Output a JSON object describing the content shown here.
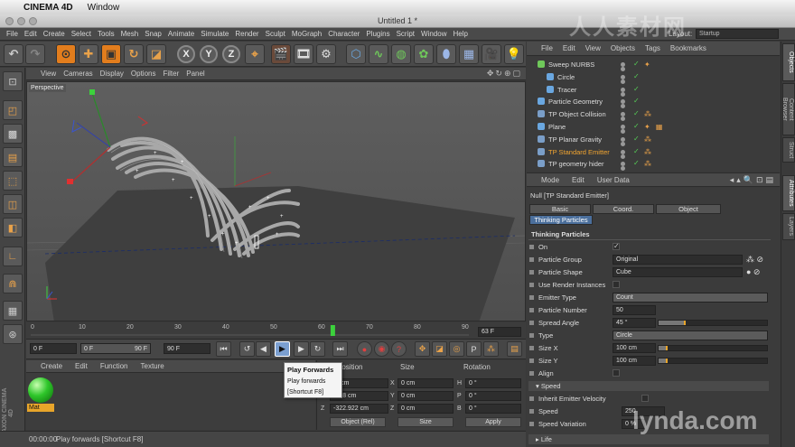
{
  "mac": {
    "apple": "",
    "app": "CINEMA 4D",
    "window": "Window"
  },
  "title": "Untitled 1 *",
  "menu": [
    "File",
    "Edit",
    "Create",
    "Select",
    "Tools",
    "Mesh",
    "Snap",
    "Animate",
    "Simulate",
    "Render",
    "Sculpt",
    "MoGraph",
    "Character",
    "Plugins",
    "Script",
    "Window",
    "Help"
  ],
  "layout_label": "Layout:",
  "layout_value": "Startup",
  "axis": {
    "x": "X",
    "y": "Y",
    "z": "Z"
  },
  "viewport_menu": [
    "View",
    "Cameras",
    "Display",
    "Options",
    "Filter",
    "Panel"
  ],
  "viewport_label": "Perspective",
  "timeline": {
    "ticks": [
      "0",
      "10",
      "20",
      "30",
      "40",
      "50",
      "60",
      "70",
      "80",
      "90"
    ],
    "current": "63 F",
    "playhead_fraction": 0.63
  },
  "transport": {
    "start": "0 F",
    "min": "0 F",
    "max": "90 F",
    "end": "90 F"
  },
  "tooltip": {
    "title": "Play Forwards",
    "desc": "Play forwards",
    "shortcut": "[Shortcut F8]"
  },
  "mat_menu": [
    "Create",
    "Edit",
    "Function",
    "Texture"
  ],
  "material": {
    "name": "Mat",
    "color": "#2ec62a"
  },
  "coord": {
    "headers": [
      "Position",
      "Size",
      "Rotation"
    ],
    "pos": [
      "-0 cm",
      "-868 cm",
      "-322.922 cm"
    ],
    "size_labels": [
      "X",
      "Y",
      "Z"
    ],
    "size": [
      "0 cm",
      "0 cm",
      "0 cm"
    ],
    "rot_labels": [
      "H",
      "P",
      "B"
    ],
    "rot": [
      "0 °",
      "0 °",
      "0 °"
    ],
    "mode": "Object (Rel)",
    "size_mode": "Size",
    "apply": "Apply"
  },
  "status": {
    "time": "00:00:00",
    "message": "Play forwards [Shortcut F8]"
  },
  "obj_menu": [
    "File",
    "Edit",
    "View",
    "Objects",
    "Tags",
    "Bookmarks"
  ],
  "objects": [
    {
      "name": "Sweep NURBS",
      "indent": 0,
      "color": "#6fc85a",
      "tag": "✦"
    },
    {
      "name": "Circle",
      "indent": 1,
      "color": "#6aa7e0",
      "tag": ""
    },
    {
      "name": "Tracer",
      "indent": 1,
      "color": "#6aa7e0",
      "tag": ""
    },
    {
      "name": "Particle Geometry",
      "indent": 0,
      "color": "#6aa7e0",
      "tag": ""
    },
    {
      "name": "TP Object Collision",
      "indent": 0,
      "color": "#7a9ec8",
      "tag": "⁂"
    },
    {
      "name": "Plane",
      "indent": 0,
      "color": "#6aa7e0",
      "tag": "✦ ▦"
    },
    {
      "name": "TP Planar Gravity",
      "indent": 0,
      "color": "#7a9ec8",
      "tag": "⁂"
    },
    {
      "name": "TP Standard Emitter",
      "indent": 0,
      "color": "#7a9ec8",
      "tag": "⁂",
      "active": true
    },
    {
      "name": "TP geometry hider",
      "indent": 0,
      "color": "#7a9ec8",
      "tag": "⁂"
    }
  ],
  "attr_menu": [
    "Mode",
    "Edit",
    "User Data"
  ],
  "attr_object": "Null [TP Standard Emitter]",
  "attr_tabs": [
    "Basic",
    "Coord.",
    "Object"
  ],
  "attr_tab_active": "Thinking Particles",
  "section": "Thinking Particles",
  "props": {
    "on": "On",
    "on_check": "✓",
    "particle_group": "Particle Group",
    "particle_group_val": "Original",
    "particle_shape": "Particle Shape",
    "particle_shape_val": "Cube",
    "use_render": "Use Render Instances",
    "emitter_type": "Emitter Type",
    "emitter_type_val": "Count",
    "particle_number": "Particle Number",
    "particle_number_val": "50",
    "spread_angle": "Spread Angle",
    "spread_angle_val": "45 °",
    "spread_fraction": 0.25,
    "type": "Type",
    "type_val": "Circle",
    "size_x": "Size X",
    "size_x_val": "100 cm",
    "size_y": "Size Y",
    "size_y_val": "100 cm",
    "align": "Align",
    "speed_section": "Speed",
    "inherit": "Inherit Emitter Velocity",
    "speed": "Speed",
    "speed_val": "250",
    "speed_var": "Speed Variation",
    "speed_var_val": "0 %",
    "life_section": "Life"
  },
  "side_tabs_top": [
    "Objects",
    "Content Browser",
    "Struct"
  ],
  "side_tabs_bottom": [
    "Attributes",
    "Layers"
  ],
  "watermark": "人人素材网",
  "lynda": "lynda.com"
}
